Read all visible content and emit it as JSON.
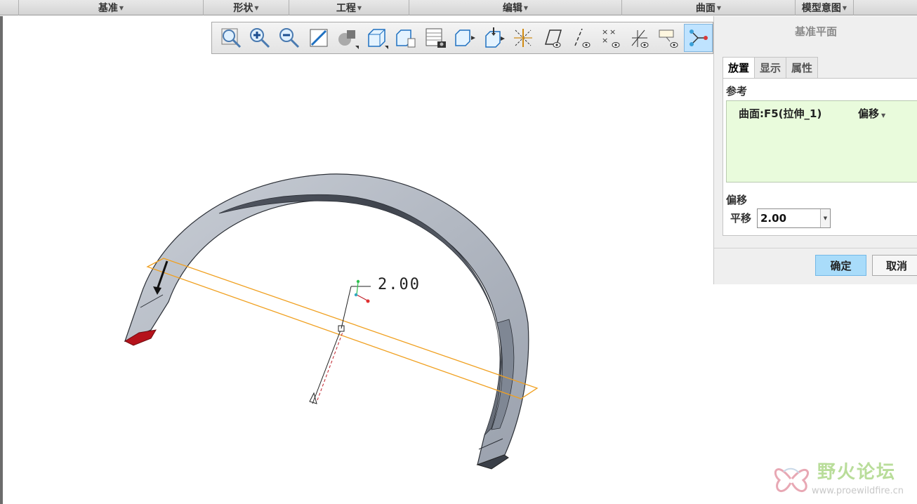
{
  "menubar": {
    "items": [
      {
        "label": "基准"
      },
      {
        "label": "形状"
      },
      {
        "label": "工程"
      },
      {
        "label": "编辑"
      },
      {
        "label": "曲面"
      },
      {
        "label": "模型意图"
      }
    ]
  },
  "toolbar": {
    "icons": [
      "zoom-fit-icon",
      "zoom-in-icon",
      "zoom-out-icon",
      "repaint-icon",
      "shading-icon",
      "display-style-icon",
      "saved-views-icon",
      "view-manager-icon",
      "named-view-icon",
      "orient-icon",
      "perspective-icon",
      "plane-display-icon",
      "axis-display-icon",
      "point-display-icon",
      "csys-display-icon",
      "annotation-display-icon",
      "spin-center-icon"
    ],
    "active_icon": "spin-center-icon"
  },
  "dialog": {
    "title": "基准平面",
    "tabs": [
      {
        "label": "放置",
        "active": true
      },
      {
        "label": "显示",
        "active": false
      },
      {
        "label": "属性",
        "active": false
      }
    ],
    "references_label": "参考",
    "reference": {
      "text": "曲面:F5(拉伸_1)",
      "constraint": "偏移"
    },
    "offset_label": "偏移",
    "translation": {
      "label": "平移",
      "value": "2.00"
    },
    "ok_label": "确定",
    "cancel_label": "取消"
  },
  "viewport": {
    "dimension_label": "2.00"
  },
  "watermark": {
    "title": "野火论坛",
    "url": "www.proewildfire.cn"
  },
  "colors": {
    "accent": "#a9dcfa",
    "reference_bg": "#e9fbdc",
    "datum_plane": "#f0a020",
    "model_face": "#8f96a3"
  }
}
